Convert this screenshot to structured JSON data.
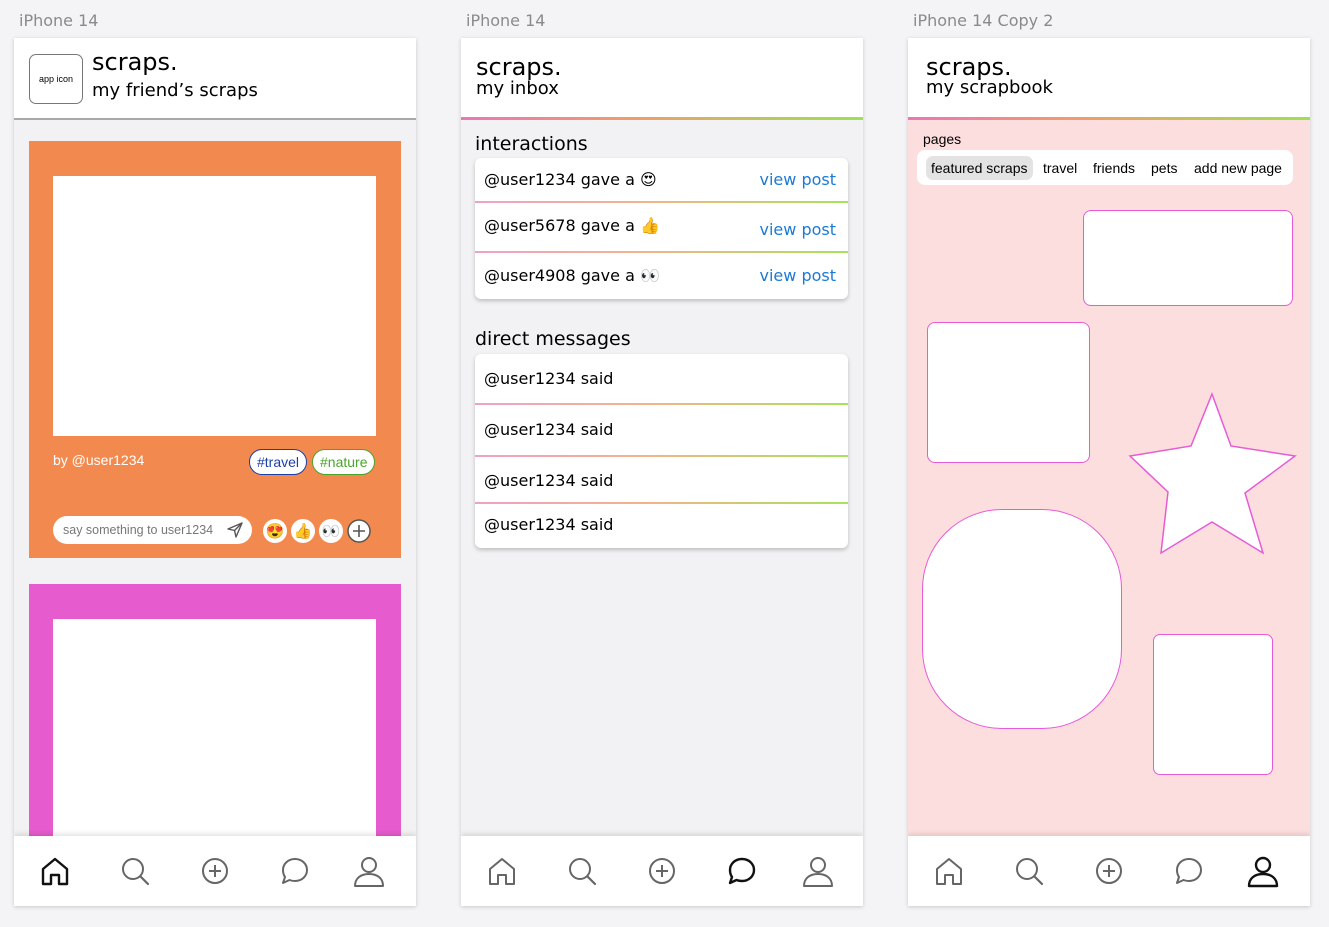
{
  "frames": [
    {
      "label": "iPhone 14"
    },
    {
      "label": "iPhone 14"
    },
    {
      "label": "iPhone 14 Copy 2"
    }
  ],
  "feed": {
    "app_icon_label": "app icon",
    "title": "scraps.",
    "subtitle": "my friend’s scraps",
    "card": {
      "author": "by @user1234",
      "tags": [
        "#travel",
        "#nature"
      ],
      "comment_placeholder": "say something to user1234",
      "reactions": [
        "😍",
        "👍",
        "👀"
      ]
    },
    "colors": {
      "card1": "#f2894e",
      "card2": "#e65bce"
    }
  },
  "inbox": {
    "title": "scraps.",
    "subtitle": "my inbox",
    "interactions_title": "interactions",
    "interactions": [
      {
        "text": "@user1234 gave a 😍",
        "link": "view post"
      },
      {
        "text": "@user5678 gave a 👍",
        "link": "view post"
      },
      {
        "text": "@user4908 gave a 👀",
        "link": "view post"
      }
    ],
    "dm_title": "direct messages",
    "messages": [
      "@user1234 said",
      "@user1234 said",
      "@user1234 said",
      "@user1234 said"
    ]
  },
  "scrapbook": {
    "title": "scraps.",
    "subtitle": "my scrapbook",
    "pages_label": "pages",
    "pages": [
      "featured scraps",
      "travel",
      "friends",
      "pets",
      "add new page"
    ],
    "active_page": "featured scraps",
    "colors": {
      "background": "#fddede",
      "border": "#e65bd6"
    }
  },
  "nav_items": [
    "home-icon",
    "search-icon",
    "add-icon",
    "chat-icon",
    "profile-icon"
  ]
}
